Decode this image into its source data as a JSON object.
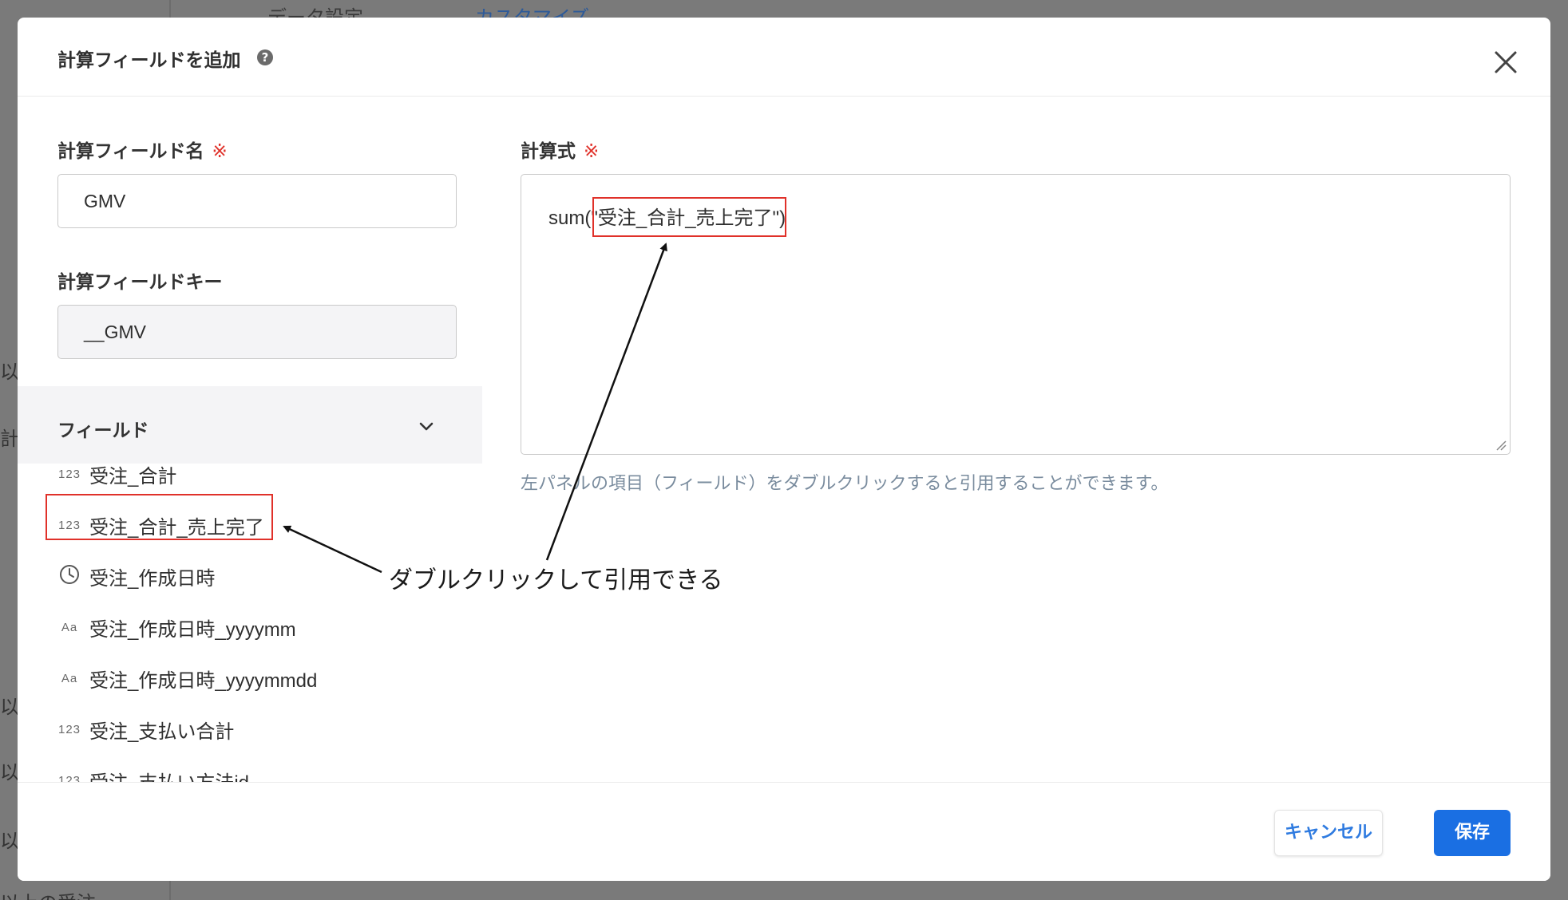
{
  "background": {
    "tabs": [
      "データ設定",
      "カスタマイズ"
    ],
    "side_texts": [
      "以",
      "計(",
      "以",
      "以",
      "以",
      "以上の受注"
    ]
  },
  "modal": {
    "title": "計算フィールドを追加",
    "help_icon": "?",
    "close_icon": "close-icon"
  },
  "form": {
    "name_label": "計算フィールド名",
    "required_mark": "※",
    "name_value": "GMV",
    "key_label": "計算フィールドキー",
    "key_value": "__GMV",
    "formula_label": "計算式",
    "formula_value": "sum(\"受注_合計_売上完了\")",
    "hint": "左パネルの項目（フィールド）をダブルクリックすると引用することができます。"
  },
  "fields": {
    "title": "フィールド",
    "items": [
      {
        "type": "123",
        "name": "受注_合計"
      },
      {
        "type": "123",
        "name": "受注_合計_売上完了"
      },
      {
        "type": "clock",
        "name": "受注_作成日時"
      },
      {
        "type": "Aa",
        "name": "受注_作成日時_yyyymm"
      },
      {
        "type": "Aa",
        "name": "受注_作成日時_yyyymmdd"
      },
      {
        "type": "123",
        "name": "受注_支払い合計"
      },
      {
        "type": "123",
        "name": "受注_支払い方法id"
      }
    ]
  },
  "footer": {
    "cancel_label": "キャンセル",
    "save_label": "保存"
  },
  "annotation": {
    "text": "ダブルクリックして引用できる"
  },
  "colors": {
    "primary": "#1a6fe3",
    "required": "#e0312a",
    "annotation": "#e0312a",
    "hint": "#7a8c9e"
  }
}
